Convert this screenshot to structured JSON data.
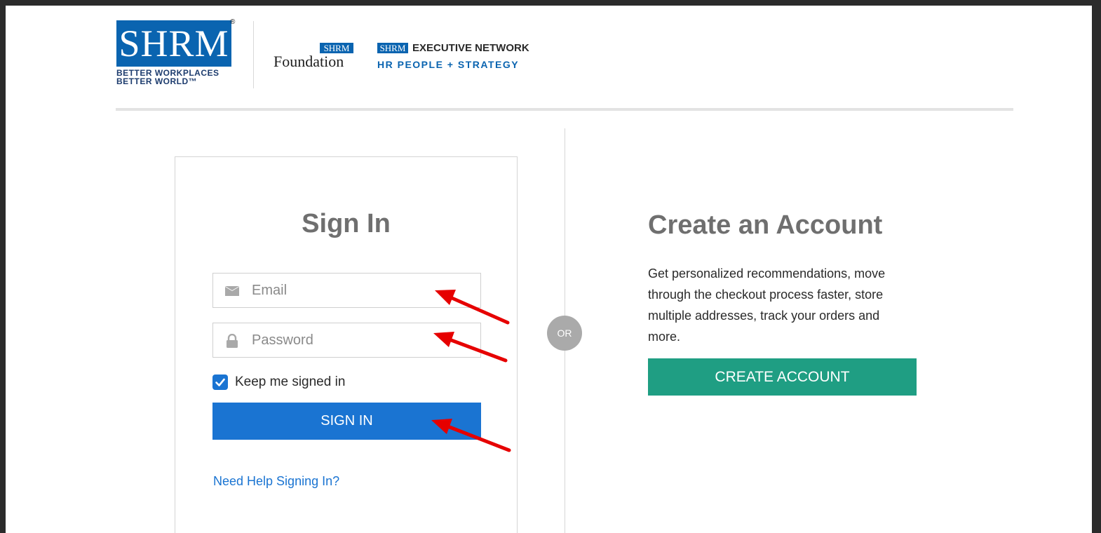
{
  "header": {
    "logo_text": "SHRM",
    "logo_registered": "®",
    "tagline_line1": "BETTER WORKPLACES",
    "tagline_line2": "BETTER WORLD™",
    "foundation_badge": "SHRM",
    "foundation_text": "Foundation",
    "exec_badge": "SHRM",
    "exec_text": "EXECUTIVE NETWORK",
    "hrps_prefix": "HR PEOPLE",
    "hrps_plus": "+",
    "hrps_suffix": "STRATEGY"
  },
  "signin": {
    "title": "Sign In",
    "email_placeholder": "Email",
    "email_value": "",
    "password_placeholder": "Password",
    "password_value": "",
    "keep_signed_in_label": "Keep me signed in",
    "keep_signed_in_checked": true,
    "button_label": "SIGN IN",
    "help_link": "Need Help Signing In?"
  },
  "divider": {
    "or_label": "OR"
  },
  "create": {
    "title": "Create an Account",
    "description": "Get personalized recommendations, move through the checkout process faster, store multiple addresses, track your orders and more.",
    "button_label": "CREATE ACCOUNT"
  },
  "colors": {
    "brand_blue": "#0a64b0",
    "signin_button": "#1a74d2",
    "create_button": "#1f9e83",
    "annotation_arrow": "#e60000"
  },
  "icons": {
    "email_field": "envelope-icon",
    "password_field": "lock-icon",
    "checkbox": "checkmark-icon"
  }
}
